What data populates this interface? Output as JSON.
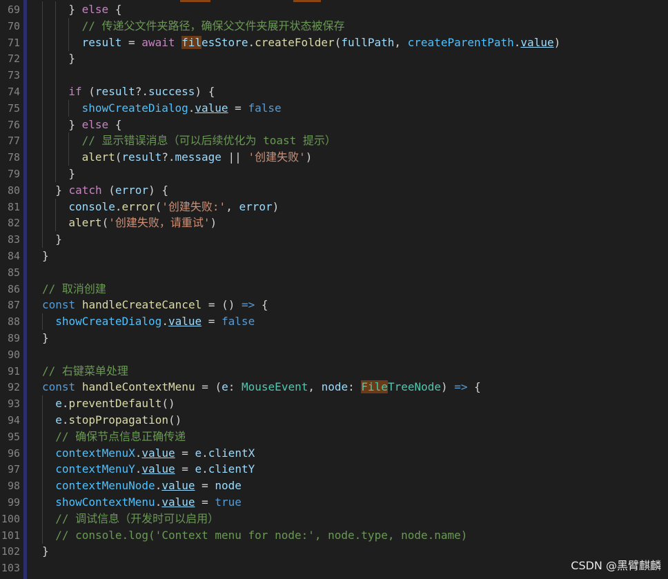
{
  "theme": {
    "kw": "#c586c0",
    "sk": "#569cd6",
    "var": "#9cdcfe",
    "fn": "#dcdcaa",
    "str": "#ce9178",
    "cm": "#6a9955",
    "type": "#4ec9b0",
    "txt": "#d4d4d4",
    "const": "#4fc1ff",
    "bool": "#569cd6"
  },
  "editor": {
    "first_line": 69,
    "lines": [
      {
        "n": "69",
        "indent": 2,
        "t": [
          [
            "txt",
            "} "
          ],
          [
            "kw",
            "else"
          ],
          [
            "txt",
            " {"
          ]
        ]
      },
      {
        "n": "70",
        "indent": 3,
        "t": [
          [
            "cm",
            "// 传递父文件夹路径，确保父文件夹展开状态被保存"
          ]
        ]
      },
      {
        "n": "71",
        "indent": 3,
        "t": [
          [
            "var",
            "result"
          ],
          [
            "txt",
            " = "
          ],
          [
            "kw",
            "await"
          ],
          [
            "txt",
            " "
          ],
          [
            "var_hl",
            "fil"
          ],
          [
            "var",
            "esStore"
          ],
          [
            "txt",
            "."
          ],
          [
            "fn",
            "createFolder"
          ],
          [
            "txt",
            "("
          ],
          [
            "var",
            "fullPath"
          ],
          [
            "txt",
            ", "
          ],
          [
            "const",
            "createParentPath"
          ],
          [
            "txt",
            "."
          ],
          [
            "var_ul",
            "value"
          ],
          [
            "txt",
            ")"
          ]
        ]
      },
      {
        "n": "72",
        "indent": 2,
        "t": [
          [
            "txt",
            "}"
          ]
        ]
      },
      {
        "n": "73",
        "indent": 2,
        "t": []
      },
      {
        "n": "74",
        "indent": 2,
        "t": [
          [
            "kw",
            "if"
          ],
          [
            "txt",
            " ("
          ],
          [
            "var",
            "result"
          ],
          [
            "txt",
            "?."
          ],
          [
            "var",
            "success"
          ],
          [
            "txt",
            ") {"
          ]
        ]
      },
      {
        "n": "75",
        "indent": 3,
        "t": [
          [
            "const",
            "showCreateDialog"
          ],
          [
            "txt",
            "."
          ],
          [
            "var_ul",
            "value"
          ],
          [
            "txt",
            " = "
          ],
          [
            "bool",
            "false"
          ]
        ]
      },
      {
        "n": "76",
        "indent": 2,
        "t": [
          [
            "txt",
            "} "
          ],
          [
            "kw",
            "else"
          ],
          [
            "txt",
            " {"
          ]
        ]
      },
      {
        "n": "77",
        "indent": 3,
        "t": [
          [
            "cm",
            "// 显示错误消息（可以后续优化为 toast 提示）"
          ]
        ]
      },
      {
        "n": "78",
        "indent": 3,
        "t": [
          [
            "fn",
            "alert"
          ],
          [
            "txt",
            "("
          ],
          [
            "var",
            "result"
          ],
          [
            "txt",
            "?."
          ],
          [
            "var",
            "message"
          ],
          [
            "txt",
            " || "
          ],
          [
            "str",
            "'创建失败'"
          ],
          [
            "txt",
            ")"
          ]
        ]
      },
      {
        "n": "79",
        "indent": 2,
        "t": [
          [
            "txt",
            "}"
          ]
        ]
      },
      {
        "n": "80",
        "indent": 1,
        "t": [
          [
            "txt",
            "} "
          ],
          [
            "kw",
            "catch"
          ],
          [
            "txt",
            " ("
          ],
          [
            "var",
            "error"
          ],
          [
            "txt",
            ") {"
          ]
        ]
      },
      {
        "n": "81",
        "indent": 2,
        "t": [
          [
            "var",
            "console"
          ],
          [
            "txt",
            "."
          ],
          [
            "fn",
            "error"
          ],
          [
            "txt",
            "("
          ],
          [
            "str",
            "'创建失败:'"
          ],
          [
            "txt",
            ", "
          ],
          [
            "var",
            "error"
          ],
          [
            "txt",
            ")"
          ]
        ]
      },
      {
        "n": "82",
        "indent": 2,
        "t": [
          [
            "fn",
            "alert"
          ],
          [
            "txt",
            "("
          ],
          [
            "str",
            "'创建失败，请重试'"
          ],
          [
            "txt",
            ")"
          ]
        ]
      },
      {
        "n": "83",
        "indent": 1,
        "t": [
          [
            "txt",
            "}"
          ]
        ]
      },
      {
        "n": "84",
        "indent": 0,
        "t": [
          [
            "txt",
            "}"
          ]
        ]
      },
      {
        "n": "85",
        "indent": 0,
        "t": []
      },
      {
        "n": "86",
        "indent": 0,
        "t": [
          [
            "cm",
            "// 取消创建"
          ]
        ]
      },
      {
        "n": "87",
        "indent": 0,
        "t": [
          [
            "sk",
            "const"
          ],
          [
            "txt",
            " "
          ],
          [
            "fn",
            "handleCreateCancel"
          ],
          [
            "txt",
            " = () "
          ],
          [
            "sk",
            "=>"
          ],
          [
            "txt",
            " {"
          ]
        ]
      },
      {
        "n": "88",
        "indent": 1,
        "t": [
          [
            "const",
            "showCreateDialog"
          ],
          [
            "txt",
            "."
          ],
          [
            "var_ul",
            "value"
          ],
          [
            "txt",
            " = "
          ],
          [
            "bool",
            "false"
          ]
        ]
      },
      {
        "n": "89",
        "indent": 0,
        "t": [
          [
            "txt",
            "}"
          ]
        ]
      },
      {
        "n": "90",
        "indent": 0,
        "t": []
      },
      {
        "n": "91",
        "indent": 0,
        "t": [
          [
            "cm",
            "// 右键菜单处理"
          ]
        ]
      },
      {
        "n": "92",
        "indent": 0,
        "t": [
          [
            "sk",
            "const"
          ],
          [
            "txt",
            " "
          ],
          [
            "fn",
            "handleContextMenu"
          ],
          [
            "txt",
            " = ("
          ],
          [
            "var",
            "e"
          ],
          [
            "txt",
            ": "
          ],
          [
            "type",
            "MouseEvent"
          ],
          [
            "txt",
            ", "
          ],
          [
            "var",
            "node"
          ],
          [
            "txt",
            ": "
          ],
          [
            "type_hl",
            "File"
          ],
          [
            "type",
            "TreeNode"
          ],
          [
            "txt",
            ") "
          ],
          [
            "sk",
            "=>"
          ],
          [
            "txt",
            " {"
          ]
        ]
      },
      {
        "n": "93",
        "indent": 1,
        "t": [
          [
            "var",
            "e"
          ],
          [
            "txt",
            "."
          ],
          [
            "fn",
            "preventDefault"
          ],
          [
            "txt",
            "()"
          ]
        ]
      },
      {
        "n": "94",
        "indent": 1,
        "t": [
          [
            "var",
            "e"
          ],
          [
            "txt",
            "."
          ],
          [
            "fn",
            "stopPropagation"
          ],
          [
            "txt",
            "()"
          ]
        ]
      },
      {
        "n": "95",
        "indent": 1,
        "t": [
          [
            "cm",
            "// 确保节点信息正确传递"
          ]
        ]
      },
      {
        "n": "96",
        "indent": 1,
        "t": [
          [
            "const",
            "contextMenuX"
          ],
          [
            "txt",
            "."
          ],
          [
            "var_ul",
            "value"
          ],
          [
            "txt",
            " = "
          ],
          [
            "var",
            "e"
          ],
          [
            "txt",
            "."
          ],
          [
            "var",
            "clientX"
          ]
        ]
      },
      {
        "n": "97",
        "indent": 1,
        "t": [
          [
            "const",
            "contextMenuY"
          ],
          [
            "txt",
            "."
          ],
          [
            "var_ul",
            "value"
          ],
          [
            "txt",
            " = "
          ],
          [
            "var",
            "e"
          ],
          [
            "txt",
            "."
          ],
          [
            "var",
            "clientY"
          ]
        ]
      },
      {
        "n": "98",
        "indent": 1,
        "t": [
          [
            "const",
            "contextMenuNode"
          ],
          [
            "txt",
            "."
          ],
          [
            "var_ul",
            "value"
          ],
          [
            "txt",
            " = "
          ],
          [
            "var",
            "node"
          ]
        ]
      },
      {
        "n": "99",
        "indent": 1,
        "t": [
          [
            "const",
            "showContextMenu"
          ],
          [
            "txt",
            "."
          ],
          [
            "var_ul",
            "value"
          ],
          [
            "txt",
            " = "
          ],
          [
            "bool",
            "true"
          ]
        ]
      },
      {
        "n": "100",
        "indent": 1,
        "t": [
          [
            "cm",
            "// 调试信息（开发时可以启用）"
          ]
        ]
      },
      {
        "n": "101",
        "indent": 1,
        "t": [
          [
            "cm",
            "// console.log('Context menu for node:', node.type, node.name)"
          ]
        ]
      },
      {
        "n": "102",
        "indent": 0,
        "t": [
          [
            "txt",
            "}"
          ]
        ]
      },
      {
        "n": "103",
        "indent": 0,
        "t": []
      }
    ]
  },
  "watermark": "CSDN @黑臂麒麟"
}
